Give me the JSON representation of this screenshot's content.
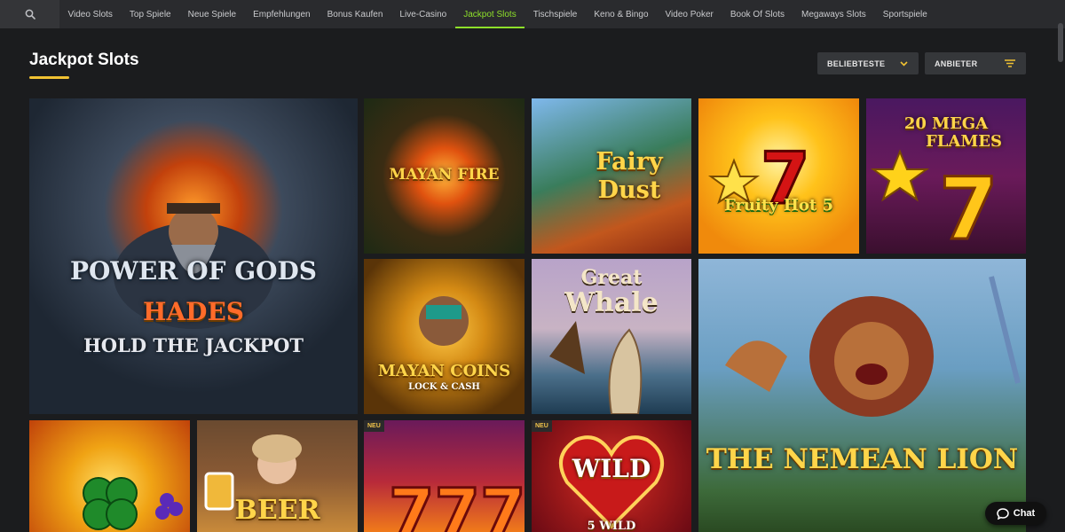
{
  "nav": {
    "search_icon": "search-icon",
    "items": [
      {
        "label": "Video Slots",
        "active": false
      },
      {
        "label": "Top Spiele",
        "active": false
      },
      {
        "label": "Neue Spiele",
        "active": false
      },
      {
        "label": "Empfehlungen",
        "active": false
      },
      {
        "label": "Bonus Kaufen",
        "active": false
      },
      {
        "label": "Live-Casino",
        "active": false
      },
      {
        "label": "Jackpot Slots",
        "active": true
      },
      {
        "label": "Tischspiele",
        "active": false
      },
      {
        "label": "Keno & Bingo",
        "active": false
      },
      {
        "label": "Video Poker",
        "active": false
      },
      {
        "label": "Book Of Slots",
        "active": false
      },
      {
        "label": "Megaways Slots",
        "active": false
      },
      {
        "label": "Sportspiele",
        "active": false
      }
    ],
    "accent": "#8ee02a"
  },
  "page": {
    "title": "Jackpot Slots",
    "underline_color": "#f1c232"
  },
  "filters": {
    "sort_label": "BELIEBTESTE",
    "provider_label": "ANBIETER"
  },
  "games": {
    "power_of_gods": {
      "line1": "POWER OF GODS",
      "line2": "HADES",
      "line3": "HOLD THE JACKPOT"
    },
    "mayan_fire": {
      "name": "MAYAN FIRE"
    },
    "fairy_dust": {
      "line1": "Fairy",
      "line2": "Dust"
    },
    "fruity_hot": {
      "name": "Fruity Hot 5"
    },
    "mega_flames": {
      "line1": "20 MEGA",
      "line2": "FLAMES"
    },
    "mayan_coins": {
      "line1": "MAYAN COINS",
      "line2": "LOCK & CASH"
    },
    "great_whale": {
      "line1": "Great",
      "line2": "Whale"
    },
    "nemean_lion": {
      "name": "THE NEMEAN LION"
    },
    "clover": {
      "name": ""
    },
    "beer": {
      "name": "BEER"
    },
    "sevens": {
      "badge": "NEU"
    },
    "wild": {
      "badge": "NEU",
      "line1": "WILD",
      "line2": "5 WILD"
    }
  },
  "chat": {
    "label": "Chat"
  }
}
